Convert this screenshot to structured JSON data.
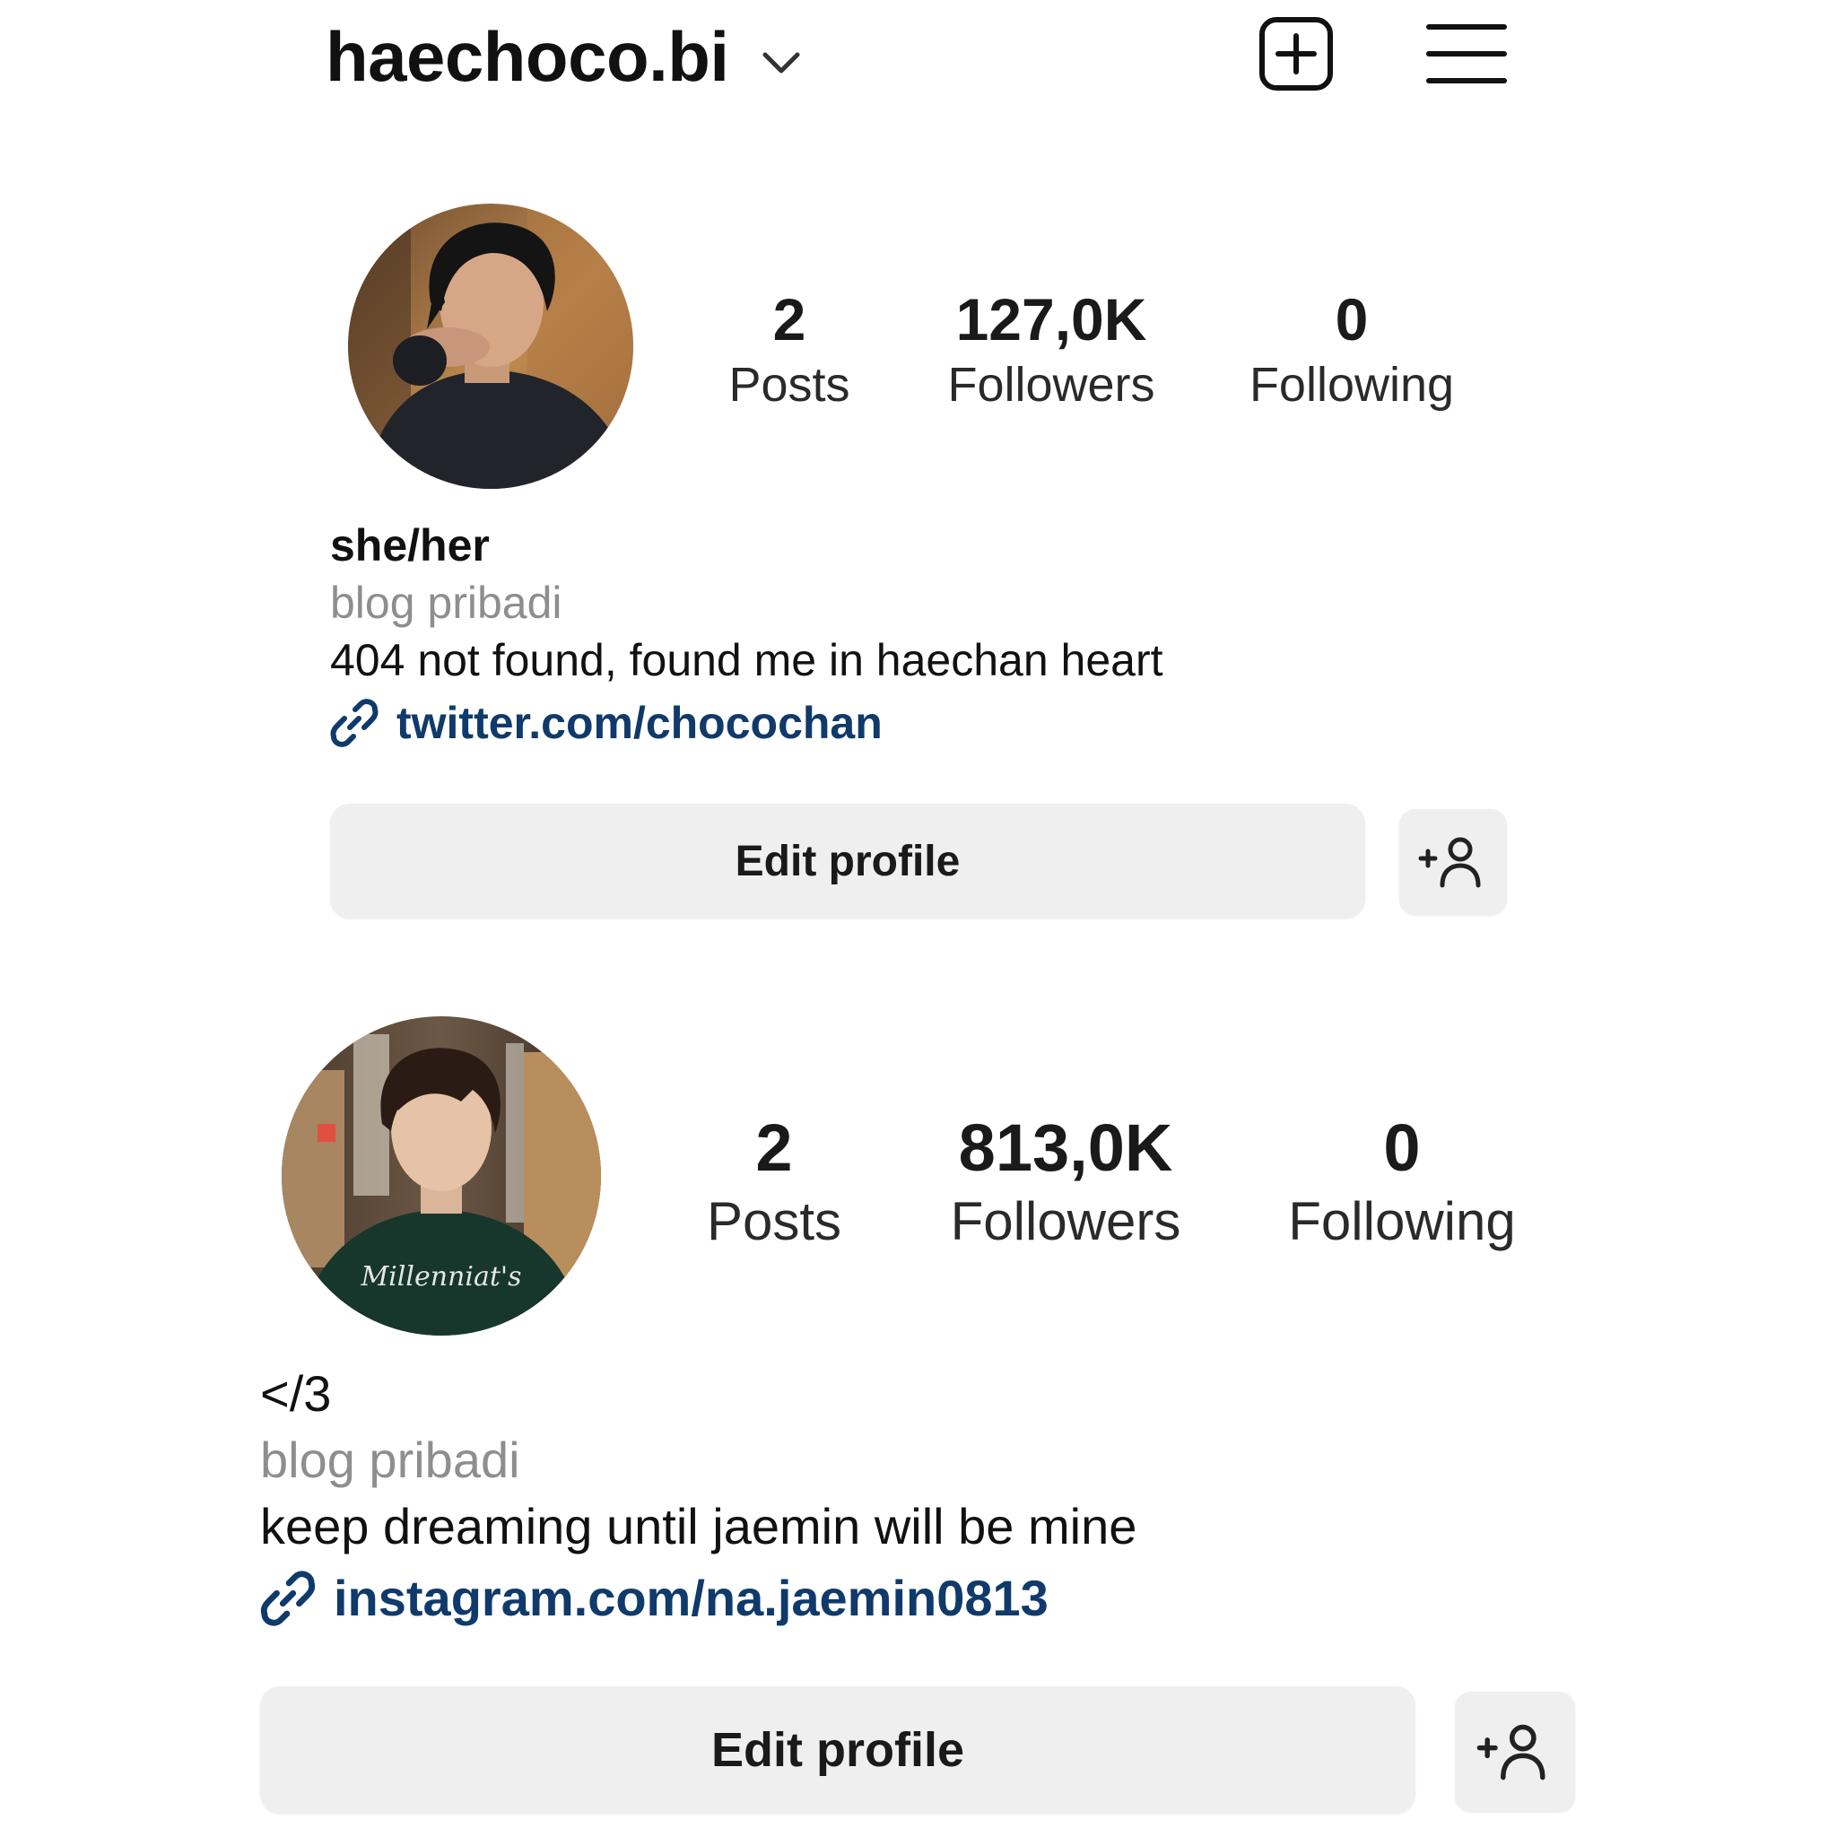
{
  "header": {
    "username": "haechoco.bi",
    "dropdown_icon": "chevron-down-icon",
    "new_post_icon": "plus-square-icon",
    "menu_icon": "hamburger-menu-icon"
  },
  "profiles": [
    {
      "avatar": "profile-photo",
      "stats": {
        "posts": {
          "value": "2",
          "label": "Posts"
        },
        "followers": {
          "value": "127,0K",
          "label": "Followers"
        },
        "following": {
          "value": "0",
          "label": "Following"
        }
      },
      "pronouns": "she/her",
      "category": "blog pribadi",
      "bio": "404 not found, found me in haechan heart",
      "link": "twitter.com/chocochan",
      "link_icon": "link-icon",
      "edit_label": "Edit profile",
      "add_user_icon": "add-user-icon"
    },
    {
      "avatar": "profile-photo",
      "stats": {
        "posts": {
          "value": "2",
          "label": "Posts"
        },
        "followers": {
          "value": "813,0K",
          "label": "Followers"
        },
        "following": {
          "value": "0",
          "label": "Following"
        }
      },
      "pronouns": "</3",
      "category": "blog pribadi",
      "bio": "keep dreaming until jaemin will be mine",
      "link": "instagram.com/na.jaemin0813",
      "link_icon": "link-icon",
      "edit_label": "Edit profile",
      "add_user_icon": "add-user-icon"
    }
  ],
  "colors": {
    "link": "#0f3a6b",
    "muted": "#8e8e8e",
    "button_bg": "#efefef"
  }
}
